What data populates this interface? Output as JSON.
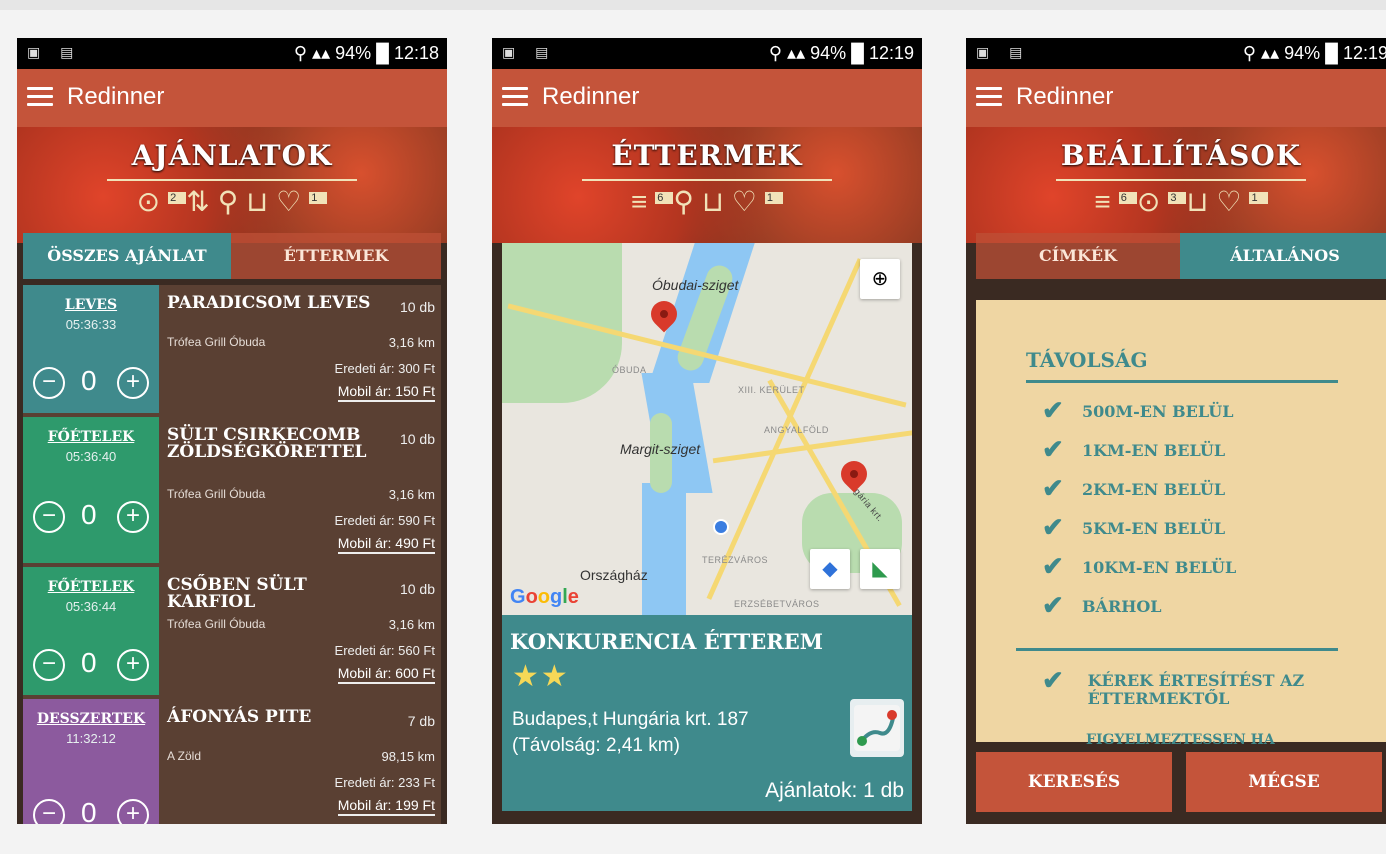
{
  "status": {
    "battery": "94%",
    "time_1": "12:18",
    "time_2": "12:19",
    "time_3": "12:19"
  },
  "app": {
    "title": "Redinner"
  },
  "screen1": {
    "heading": "AJÁNLATOK",
    "icon_badge_pin": "2",
    "icon_badge_heart": "1",
    "tabs": [
      "ÖSSZES AJÁNLAT",
      "ÉTTERMEK"
    ],
    "items": [
      {
        "category": "LEVES",
        "time": "05:36:33",
        "count": "0",
        "name": "PARADICSOM LEVES",
        "qty": "10 db",
        "restaurant": "Trófea Grill Óbuda",
        "distance": "3,16 km",
        "original": "Eredeti ár: 300 Ft",
        "mobile": "Mobil ár: 150 Ft",
        "color": "#3f8a8c"
      },
      {
        "category": "FŐÉTELEK",
        "time": "05:36:40",
        "count": "0",
        "name": "SÜLT CSIRKECOMB ZÖLDSÉGKÖRETTEL",
        "qty": "10 db",
        "restaurant": "Trófea Grill Óbuda",
        "distance": "3,16 km",
        "original": "Eredeti ár: 590 Ft",
        "mobile": "Mobil ár: 490 Ft",
        "color": "#2e9a6c"
      },
      {
        "category": "FŐÉTELEK",
        "time": "05:36:44",
        "count": "0",
        "name": "CSŐBEN SÜLT KARFIOL",
        "qty": "10 db",
        "restaurant": "Trófea Grill Óbuda",
        "distance": "3,16 km",
        "original": "Eredeti ár: 560 Ft",
        "mobile": "Mobil ár: 600 Ft",
        "color": "#2e9a6c"
      },
      {
        "category": "DESSZERTEK",
        "time": "11:32:12",
        "count": "0",
        "name": "ÁFONYÁS PITE",
        "qty": "7 db",
        "restaurant": "A Zöld",
        "distance": "98,15 km",
        "original": "Eredeti ár: 233 Ft",
        "mobile": "Mobil ár: 199 Ft",
        "color": "#8c5a9e"
      }
    ]
  },
  "screen2": {
    "heading": "ÉTTERMEK",
    "icon_badge_list": "6",
    "icon_badge_heart": "1",
    "map": {
      "labels": [
        "Óbudai-sziget",
        "ÓBUDA",
        "XIII. KERÜLET",
        "ANGYALFÖLD",
        "Margit-sziget",
        "Országház",
        "TERÉZVÁROS",
        "ERZSÉBETVÁROS",
        "Hungária krt."
      ],
      "google": "Google"
    },
    "restaurant": {
      "name": "KONKURENCIA ÉTTEREM",
      "stars": "★★",
      "address": "Budapes,t Hungária krt. 187",
      "distance": "(Távolság: 2,41 km)",
      "offers": "Ajánlatok: 1 db"
    }
  },
  "screen3": {
    "heading": "BEÁLLÍTÁSOK",
    "icon_badge_list": "6",
    "icon_badge_pin": "3",
    "icon_badge_heart": "1",
    "tabs": [
      "CÍMKÉK",
      "ÁLTALÁNOS"
    ],
    "section": "TÁVOLSÁG",
    "options": [
      "500M-EN BELÜL",
      "1KM-EN BELÜL",
      "2KM-EN BELÜL",
      "5KM-EN BELÜL",
      "10KM-EN BELÜL",
      "BÁRHOL"
    ],
    "notify": "KÉREK ÉRTESÍTÉST AZ ÉTTERMEKTŐL",
    "cutoff": "FIGYELMEZTESSEN HA",
    "buttons": {
      "search": "KERESÉS",
      "cancel": "MÉGSE"
    }
  }
}
